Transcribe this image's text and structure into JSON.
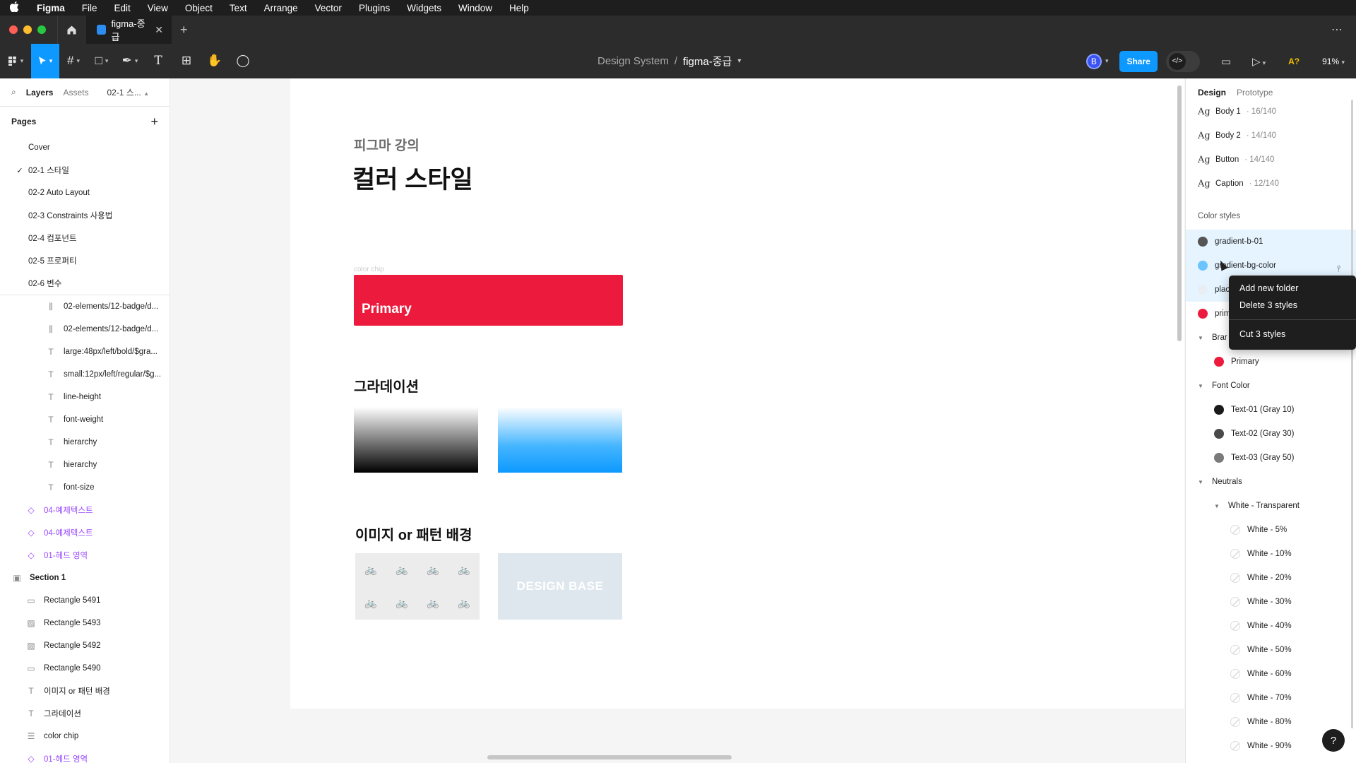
{
  "menubar": {
    "apple": "",
    "items": [
      "Figma",
      "File",
      "Edit",
      "View",
      "Object",
      "Text",
      "Arrange",
      "Vector",
      "Plugins",
      "Widgets",
      "Window",
      "Help"
    ]
  },
  "titlebar": {
    "tab_title": "figma-중급",
    "close": "✕",
    "plus": "+",
    "more": "⋯"
  },
  "toolbar": {
    "breadcrumb_project": "Design System",
    "breadcrumb_sep": "/",
    "breadcrumb_file": "figma-중급",
    "avatar": "B",
    "share": "Share",
    "devmode": "</>",
    "ai_label": "A?",
    "zoom": "91%"
  },
  "left_panel": {
    "tab_layers": "Layers",
    "tab_assets": "Assets",
    "page_indicator": "02-1 스...",
    "pages_heading": "Pages",
    "add": "+",
    "pages": [
      {
        "label": "Cover",
        "current": false
      },
      {
        "label": "02-1 스타일",
        "current": true
      },
      {
        "label": "02-2 Auto Layout",
        "current": false
      },
      {
        "label": "02-3 Constraints 사용법",
        "current": false
      },
      {
        "label": "02-4 컴포넌트",
        "current": false
      },
      {
        "label": "02-5 프로퍼티",
        "current": false
      },
      {
        "label": "02-6 변수",
        "current": false
      }
    ],
    "layers": [
      {
        "label": "02-elements/12-badge/d...",
        "icon": "instance",
        "indent": 1,
        "kind": "normal"
      },
      {
        "label": "02-elements/12-badge/d...",
        "icon": "instance",
        "indent": 1,
        "kind": "normal"
      },
      {
        "label": "large:48px/left/bold/$gra...",
        "icon": "text",
        "indent": 1,
        "kind": "normal"
      },
      {
        "label": "small:12px/left/regular/$g...",
        "icon": "text",
        "indent": 1,
        "kind": "normal"
      },
      {
        "label": "line-height",
        "icon": "text",
        "indent": 1,
        "kind": "normal"
      },
      {
        "label": "font-weight",
        "icon": "text",
        "indent": 1,
        "kind": "normal"
      },
      {
        "label": "hierarchy",
        "icon": "text",
        "indent": 1,
        "kind": "normal"
      },
      {
        "label": "hierarchy",
        "icon": "text",
        "indent": 1,
        "kind": "normal"
      },
      {
        "label": "font-size",
        "icon": "text",
        "indent": 1,
        "kind": "normal"
      },
      {
        "label": "04-예제텍스트",
        "icon": "component",
        "indent": 0,
        "kind": "comp"
      },
      {
        "label": "04-예제텍스트",
        "icon": "component",
        "indent": 0,
        "kind": "comp"
      },
      {
        "label": "01-헤드 영역",
        "icon": "component",
        "indent": 0,
        "kind": "comp"
      },
      {
        "label": "Section 1",
        "icon": "section",
        "indent": -1,
        "kind": "sect"
      },
      {
        "label": "Rectangle 5491",
        "icon": "rect",
        "indent": 0,
        "kind": "normal"
      },
      {
        "label": "Rectangle 5493",
        "icon": "image",
        "indent": 0,
        "kind": "normal"
      },
      {
        "label": "Rectangle 5492",
        "icon": "image",
        "indent": 0,
        "kind": "normal"
      },
      {
        "label": "Rectangle 5490",
        "icon": "rect",
        "indent": 0,
        "kind": "normal"
      },
      {
        "label": "이미지 or 패턴 배경",
        "icon": "text",
        "indent": 0,
        "kind": "normal"
      },
      {
        "label": "그라데이션",
        "icon": "text",
        "indent": 0,
        "kind": "normal"
      },
      {
        "label": "color chip",
        "icon": "list",
        "indent": 0,
        "kind": "normal"
      },
      {
        "label": "01-헤드 영역",
        "icon": "component",
        "indent": 0,
        "kind": "comp"
      }
    ]
  },
  "canvas": {
    "subtitle": "피그마 강의",
    "title": "컬러 스타일",
    "chip_label": "color chip",
    "chip_text": "Primary",
    "chip_color": "#ec1a3c",
    "gradient_heading": "그라데이션",
    "pattern_heading": "이미지 or 패턴 배경",
    "pattern_glyph": "🚲",
    "design_base": "DESIGN BASE"
  },
  "right_panel": {
    "tab_design": "Design",
    "tab_prototype": "Prototype",
    "text_styles": [
      {
        "name": "Body 1",
        "meta": "· 16/140"
      },
      {
        "name": "Body 2",
        "meta": "· 14/140"
      },
      {
        "name": "Button",
        "meta": "· 14/140"
      },
      {
        "name": "Caption",
        "meta": "· 12/140"
      }
    ],
    "ag": "Ag",
    "color_styles_heading": "Color styles",
    "color_rows": [
      {
        "label": "gradient-b-01",
        "swatch": "#555555",
        "indent": 0,
        "sel": true,
        "arrow": false
      },
      {
        "label": "gradient-bg-color",
        "swatch": "#6cc4ff",
        "indent": 0,
        "sel": true,
        "arrow": false
      },
      {
        "label": "plac",
        "swatch": "#e8eef3",
        "indent": 0,
        "sel": true,
        "arrow": false
      },
      {
        "label": "prim",
        "swatch": "#ec1a3c",
        "indent": 0,
        "sel": false,
        "arrow": false
      },
      {
        "label": "Brar",
        "swatch": "",
        "indent": 0,
        "sel": false,
        "arrow": true
      },
      {
        "label": "Primary",
        "swatch": "#ec1a3c",
        "indent": 1,
        "sel": false,
        "arrow": false
      },
      {
        "label": "Font Color",
        "swatch": "",
        "indent": 0,
        "sel": false,
        "arrow": true
      },
      {
        "label": "Text-01 (Gray 10)",
        "swatch": "#1a1a1a",
        "indent": 1,
        "sel": false,
        "arrow": false
      },
      {
        "label": "Text-02 (Gray 30)",
        "swatch": "#4a4a4a",
        "indent": 1,
        "sel": false,
        "arrow": false
      },
      {
        "label": "Text-03 (Gray 50)",
        "swatch": "#7a7a7a",
        "indent": 1,
        "sel": false,
        "arrow": false
      },
      {
        "label": "Neutrals",
        "swatch": "",
        "indent": 0,
        "sel": false,
        "arrow": true
      },
      {
        "label": "White - Transparent",
        "swatch": "",
        "indent": 1,
        "sel": false,
        "arrow": true
      },
      {
        "label": "White - 5%",
        "swatch": "trans",
        "indent": 2,
        "sel": false,
        "arrow": false
      },
      {
        "label": "White - 10%",
        "swatch": "trans",
        "indent": 2,
        "sel": false,
        "arrow": false
      },
      {
        "label": "White - 20%",
        "swatch": "trans",
        "indent": 2,
        "sel": false,
        "arrow": false
      },
      {
        "label": "White - 30%",
        "swatch": "trans",
        "indent": 2,
        "sel": false,
        "arrow": false
      },
      {
        "label": "White - 40%",
        "swatch": "trans",
        "indent": 2,
        "sel": false,
        "arrow": false
      },
      {
        "label": "White - 50%",
        "swatch": "trans",
        "indent": 2,
        "sel": false,
        "arrow": false
      },
      {
        "label": "White - 60%",
        "swatch": "trans",
        "indent": 2,
        "sel": false,
        "arrow": false
      },
      {
        "label": "White - 70%",
        "swatch": "trans",
        "indent": 2,
        "sel": false,
        "arrow": false
      },
      {
        "label": "White - 80%",
        "swatch": "trans",
        "indent": 2,
        "sel": false,
        "arrow": false
      },
      {
        "label": "White - 90%",
        "swatch": "trans",
        "indent": 2,
        "sel": false,
        "arrow": false
      }
    ],
    "context_menu": {
      "add_folder": "Add new folder",
      "delete": "Delete 3 styles",
      "cut": "Cut 3 styles"
    },
    "help": "?"
  },
  "colors": {
    "accent": "#0d99ff",
    "menubar_bg": "#1e1e1e",
    "toolbar_bg": "#2c2c2c",
    "component_purple": "#9747ff"
  }
}
